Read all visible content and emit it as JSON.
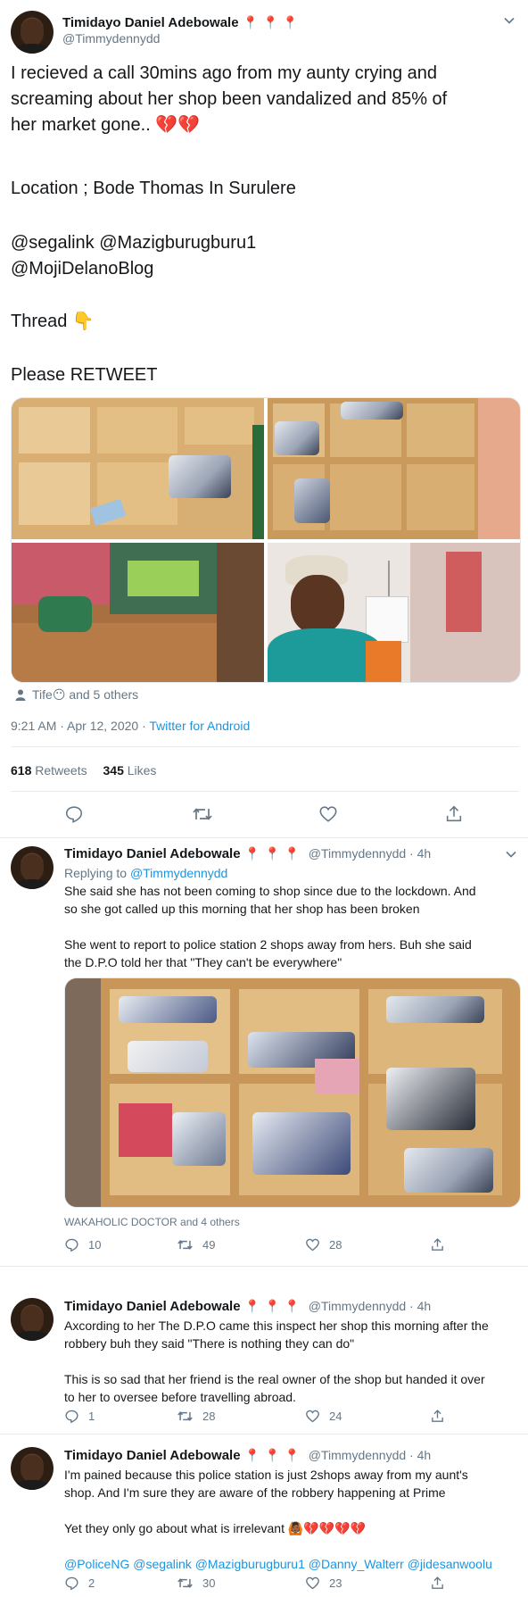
{
  "main_tweet": {
    "author_name": "Timidayo Daniel Adebowale",
    "author_emoji": "📍📍📍",
    "author_handle": "@Timmydennydd",
    "text_line1": "I recieved a call 30mins ago from my aunty crying and",
    "text_line2": "screaming about her shop been vandalized and 85% of",
    "text_line3": "her market gone.. 💔💔",
    "location": "Location ; Bode Thomas In Surulere",
    "mention_line1": "@segalink @Mazigburugburu1",
    "mention_line2": "@MojiDelanoBlog",
    "thread": "Thread 👇",
    "please": "Please RETWEET",
    "liked_by_name": "Tife😶",
    "liked_by_others": "and 5 others",
    "timestamp": "9:21 AM · Apr 12, 2020 ·",
    "source": "Twitter for Android",
    "retweets_count": "618",
    "retweets_label": "Retweets",
    "likes_count": "345",
    "likes_label": "Likes"
  },
  "replies": [
    {
      "author_name": "Timidayo Daniel Adebowale",
      "author_emoji": "📍📍📍",
      "author_handle": "@Timmydennydd · 4h",
      "replying_prefix": "Replying to",
      "replying_to": "@Timmydennydd",
      "para1_line1": "She said she has not been coming to shop since due to the lockdown. And",
      "para1_line2": "so she got called up this morning that her shop has been broken",
      "para2_line1": "She went to report to police station 2 shops away from hers. Buh she said",
      "para2_line2": "the D.P.O told her that \"They can't be everywhere\"",
      "liked_by": "WAKAHOLIC DOCTOR and 4 others",
      "reply_count": "10",
      "retweet_count": "49",
      "like_count": "28"
    },
    {
      "author_name": "Timidayo Daniel Adebowale",
      "author_emoji": "📍📍📍",
      "author_handle": "@Timmydennydd · 4h",
      "para1_line1": "Axcording to her The D.P.O came this inspect her shop this morning after the",
      "para1_line2": "robbery buh they said \"There is nothing they can do\"",
      "para2_line1": "This is so sad that her friend is the real owner of the shop but handed it over",
      "para2_line2": "to her to oversee before travelling abroad.",
      "reply_count": "1",
      "retweet_count": "28",
      "like_count": "24"
    },
    {
      "author_name": "Timidayo Daniel Adebowale",
      "author_emoji": "📍📍📍",
      "author_handle": "@Timmydennydd · 4h",
      "para1_line1": "I'm pained because this police station is just 2shops away from my aunt's",
      "para1_line2": "shop. And I'm sure they are aware of the robbery happening at Prime",
      "para2_line1": "Yet they only go about what is irrelevant 🙆🏾💔💔💔💔",
      "mentions": "@PoliceNG @segalink @Mazigburugburu1 @Danny_Walterr @jidesanwoolu",
      "reply_count": "2",
      "retweet_count": "30",
      "like_count": "23"
    }
  ],
  "icons": {
    "reply": "comment-bubble-icon",
    "retweet": "retweet-arrows-icon",
    "like": "heart-outline-icon",
    "share": "share-upload-icon",
    "more": "chevron-down-icon",
    "person": "person-silhouette-icon"
  },
  "colors": {
    "link": "#1b95e0",
    "muted": "#657786",
    "text": "#14171a",
    "divider": "#e6ecf0"
  }
}
